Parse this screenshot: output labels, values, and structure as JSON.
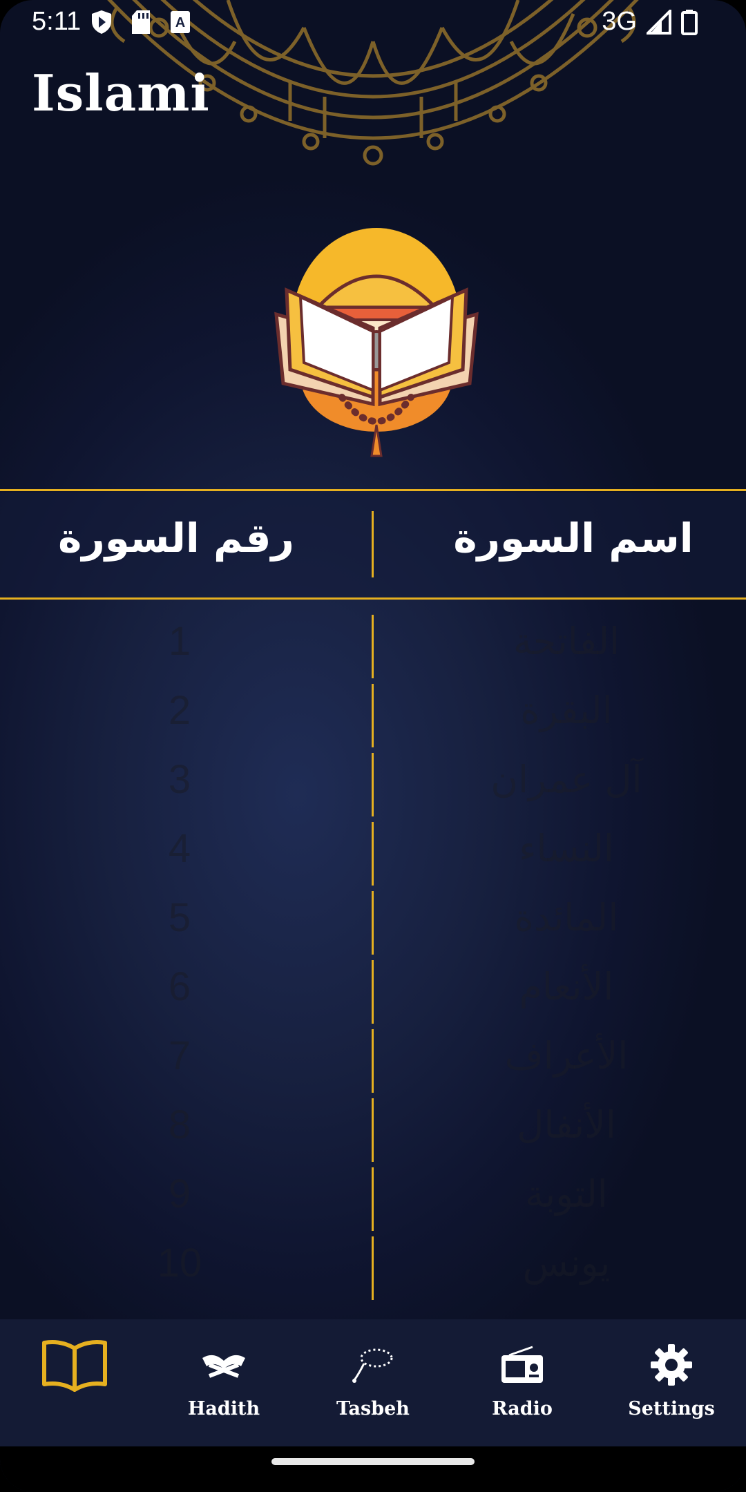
{
  "status_bar": {
    "time": "5:11",
    "network": "3G"
  },
  "app": {
    "title": "Islami"
  },
  "table_header": {
    "surah_name": "اسم السورة",
    "surah_number": "رقم السورة"
  },
  "surahs": [
    {
      "number": "1",
      "name": "الفاتحة"
    },
    {
      "number": "2",
      "name": "البقرة"
    },
    {
      "number": "3",
      "name": "آل عمران"
    },
    {
      "number": "4",
      "name": "النساء"
    },
    {
      "number": "5",
      "name": "المائدة"
    },
    {
      "number": "6",
      "name": "الأنعام"
    },
    {
      "number": "7",
      "name": "الأعراف"
    },
    {
      "number": "8",
      "name": "الأنفال"
    },
    {
      "number": "9",
      "name": "التوبة"
    },
    {
      "number": "10",
      "name": "يونس"
    }
  ],
  "bottom_nav": {
    "active": "quran",
    "items": [
      {
        "id": "quran",
        "label": "",
        "icon": "quran-book-icon"
      },
      {
        "id": "hadith",
        "label": "Hadith",
        "icon": "hadith-icon"
      },
      {
        "id": "tasbeh",
        "label": "Tasbeh",
        "icon": "tasbeh-beads-icon"
      },
      {
        "id": "radio",
        "label": "Radio",
        "icon": "radio-icon"
      },
      {
        "id": "settings",
        "label": "Settings",
        "icon": "gear-icon"
      }
    ]
  },
  "colors": {
    "accent": "#E6B020",
    "background": "#17203F",
    "nav": "#141B35"
  }
}
